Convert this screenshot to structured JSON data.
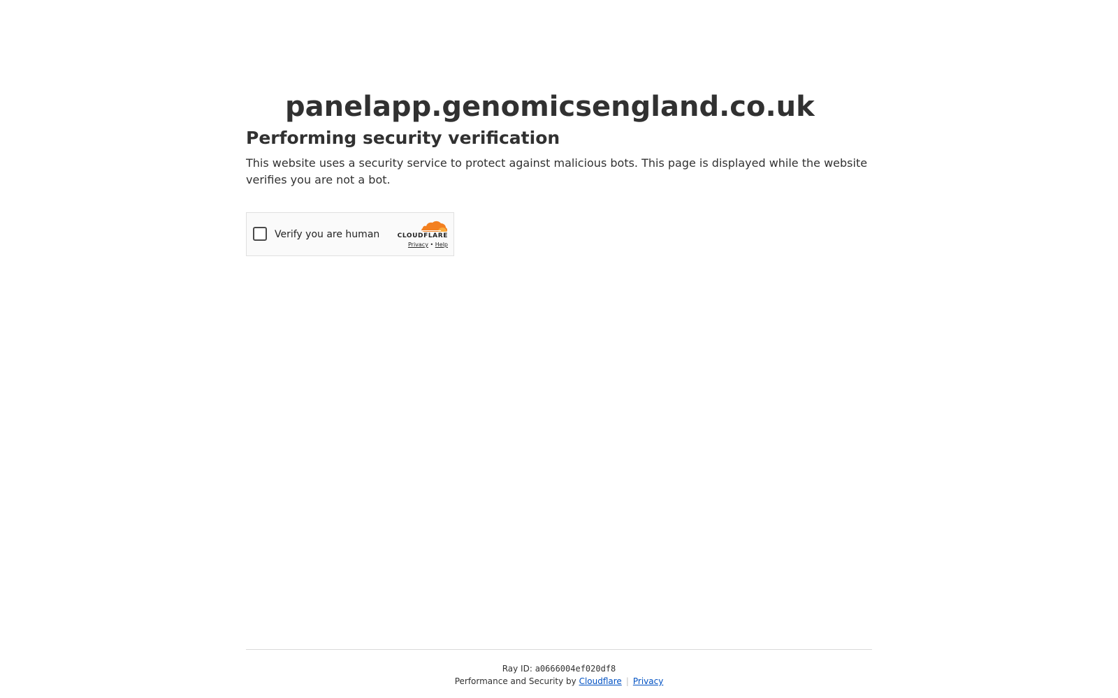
{
  "site": {
    "domain": "panelapp.genomicsengland.co.uk"
  },
  "challenge": {
    "heading": "Performing security verification",
    "description": "This website uses a security service to protect against malicious bots. This page is displayed while the website verifies you are not a bot."
  },
  "widget": {
    "checkbox_label": "Verify you are human",
    "brand_wordmark": "CLOUDFLARE",
    "privacy_link": "Privacy",
    "separator": "•",
    "help_link": "Help",
    "logo_icon": "cloudflare-cloud-icon",
    "logo_color": "#f38020"
  },
  "footer": {
    "ray_label": "Ray ID: ",
    "ray_id": "a0666004ef020df8",
    "performance_text": "Performance and Security by ",
    "cloudflare_link": "Cloudflare",
    "divider": "|",
    "privacy_link": "Privacy",
    "link_color": "#0051c3"
  }
}
